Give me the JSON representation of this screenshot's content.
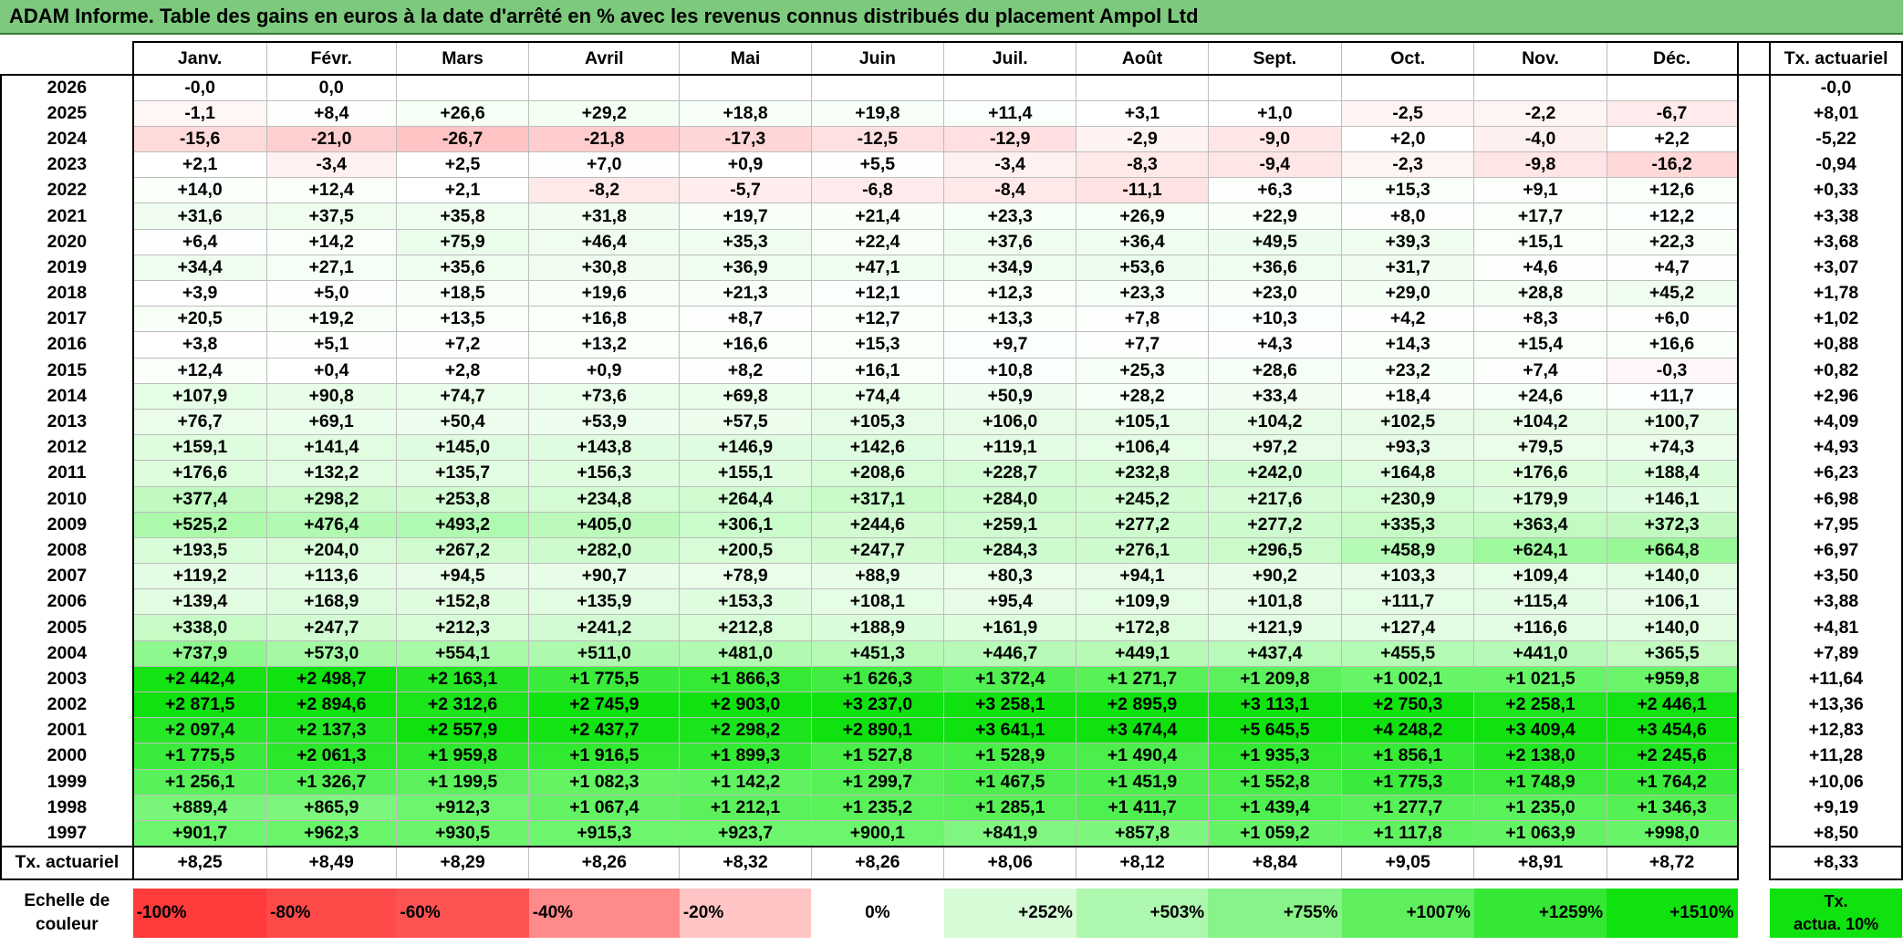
{
  "title": "ADAM Informe. Table des gains en euros à la date d'arrêté en % avec les revenus connus distribués du placement Ampol Ltd",
  "months": [
    "Janv.",
    "Févr.",
    "Mars",
    "Avril",
    "Mai",
    "Juin",
    "Juil.",
    "Août",
    "Sept.",
    "Oct.",
    "Nov.",
    "Déc."
  ],
  "tx_header": "Tx. actuariel",
  "rows": [
    {
      "year": "2026",
      "values": [
        "-0,0",
        "0,0",
        "",
        "",
        "",
        "",
        "",
        "",
        "",
        "",
        "",
        ""
      ],
      "tx": "-0,0"
    },
    {
      "year": "2025",
      "values": [
        "-1,1",
        "+8,4",
        "+26,6",
        "+29,2",
        "+18,8",
        "+19,8",
        "+11,4",
        "+3,1",
        "+1,0",
        "-2,5",
        "-2,2",
        "-6,7"
      ],
      "tx": "+8,01"
    },
    {
      "year": "2024",
      "values": [
        "-15,6",
        "-21,0",
        "-26,7",
        "-21,8",
        "-17,3",
        "-12,5",
        "-12,9",
        "-2,9",
        "-9,0",
        "+2,0",
        "-4,0",
        "+2,2"
      ],
      "tx": "-5,22"
    },
    {
      "year": "2023",
      "values": [
        "+2,1",
        "-3,4",
        "+2,5",
        "+7,0",
        "+0,9",
        "+5,5",
        "-3,4",
        "-8,3",
        "-9,4",
        "-2,3",
        "-9,8",
        "-16,2"
      ],
      "tx": "-0,94"
    },
    {
      "year": "2022",
      "values": [
        "+14,0",
        "+12,4",
        "+2,1",
        "-8,2",
        "-5,7",
        "-6,8",
        "-8,4",
        "-11,1",
        "+6,3",
        "+15,3",
        "+9,1",
        "+12,6"
      ],
      "tx": "+0,33"
    },
    {
      "year": "2021",
      "values": [
        "+31,6",
        "+37,5",
        "+35,8",
        "+31,8",
        "+19,7",
        "+21,4",
        "+23,3",
        "+26,9",
        "+22,9",
        "+8,0",
        "+17,7",
        "+12,2"
      ],
      "tx": "+3,38"
    },
    {
      "year": "2020",
      "values": [
        "+6,4",
        "+14,2",
        "+75,9",
        "+46,4",
        "+35,3",
        "+22,4",
        "+37,6",
        "+36,4",
        "+49,5",
        "+39,3",
        "+15,1",
        "+22,3"
      ],
      "tx": "+3,68"
    },
    {
      "year": "2019",
      "values": [
        "+34,4",
        "+27,1",
        "+35,6",
        "+30,8",
        "+36,9",
        "+47,1",
        "+34,9",
        "+53,6",
        "+36,6",
        "+31,7",
        "+4,6",
        "+4,7"
      ],
      "tx": "+3,07"
    },
    {
      "year": "2018",
      "values": [
        "+3,9",
        "+5,0",
        "+18,5",
        "+19,6",
        "+21,3",
        "+12,1",
        "+12,3",
        "+23,3",
        "+23,0",
        "+29,0",
        "+28,8",
        "+45,2"
      ],
      "tx": "+1,78"
    },
    {
      "year": "2017",
      "values": [
        "+20,5",
        "+19,2",
        "+13,5",
        "+16,8",
        "+8,7",
        "+12,7",
        "+13,3",
        "+7,8",
        "+10,3",
        "+4,2",
        "+8,3",
        "+6,0"
      ],
      "tx": "+1,02"
    },
    {
      "year": "2016",
      "values": [
        "+3,8",
        "+5,1",
        "+7,2",
        "+13,2",
        "+16,6",
        "+15,3",
        "+9,7",
        "+7,7",
        "+4,3",
        "+14,3",
        "+15,4",
        "+16,6"
      ],
      "tx": "+0,88"
    },
    {
      "year": "2015",
      "values": [
        "+12,4",
        "+0,4",
        "+2,8",
        "+0,9",
        "+8,2",
        "+16,1",
        "+10,8",
        "+25,3",
        "+28,6",
        "+23,2",
        "+7,4",
        "-0,3"
      ],
      "tx": "+0,82"
    },
    {
      "year": "2014",
      "values": [
        "+107,9",
        "+90,8",
        "+74,7",
        "+73,6",
        "+69,8",
        "+74,4",
        "+50,9",
        "+28,2",
        "+33,4",
        "+18,4",
        "+24,6",
        "+11,7"
      ],
      "tx": "+2,96"
    },
    {
      "year": "2013",
      "values": [
        "+76,7",
        "+69,1",
        "+50,4",
        "+53,9",
        "+57,5",
        "+105,3",
        "+106,0",
        "+105,1",
        "+104,2",
        "+102,5",
        "+104,2",
        "+100,7"
      ],
      "tx": "+4,09"
    },
    {
      "year": "2012",
      "values": [
        "+159,1",
        "+141,4",
        "+145,0",
        "+143,8",
        "+146,9",
        "+142,6",
        "+119,1",
        "+106,4",
        "+97,2",
        "+93,3",
        "+79,5",
        "+74,3"
      ],
      "tx": "+4,93"
    },
    {
      "year": "2011",
      "values": [
        "+176,6",
        "+132,2",
        "+135,7",
        "+156,3",
        "+155,1",
        "+208,6",
        "+228,7",
        "+232,8",
        "+242,0",
        "+164,8",
        "+176,6",
        "+188,4"
      ],
      "tx": "+6,23"
    },
    {
      "year": "2010",
      "values": [
        "+377,4",
        "+298,2",
        "+253,8",
        "+234,8",
        "+264,4",
        "+317,1",
        "+284,0",
        "+245,2",
        "+217,6",
        "+230,9",
        "+179,9",
        "+146,1"
      ],
      "tx": "+6,98"
    },
    {
      "year": "2009",
      "values": [
        "+525,2",
        "+476,4",
        "+493,2",
        "+405,0",
        "+306,1",
        "+244,6",
        "+259,1",
        "+277,2",
        "+277,2",
        "+335,3",
        "+363,4",
        "+372,3"
      ],
      "tx": "+7,95"
    },
    {
      "year": "2008",
      "values": [
        "+193,5",
        "+204,0",
        "+267,2",
        "+282,0",
        "+200,5",
        "+247,7",
        "+284,3",
        "+276,1",
        "+296,5",
        "+458,9",
        "+624,1",
        "+664,8"
      ],
      "tx": "+6,97"
    },
    {
      "year": "2007",
      "values": [
        "+119,2",
        "+113,6",
        "+94,5",
        "+90,7",
        "+78,9",
        "+88,9",
        "+80,3",
        "+94,1",
        "+90,2",
        "+103,3",
        "+109,4",
        "+140,0"
      ],
      "tx": "+3,50"
    },
    {
      "year": "2006",
      "values": [
        "+139,4",
        "+168,9",
        "+152,8",
        "+135,9",
        "+153,3",
        "+108,1",
        "+95,4",
        "+109,9",
        "+101,8",
        "+111,7",
        "+115,4",
        "+106,1"
      ],
      "tx": "+3,88"
    },
    {
      "year": "2005",
      "values": [
        "+338,0",
        "+247,7",
        "+212,3",
        "+241,2",
        "+212,8",
        "+188,9",
        "+161,9",
        "+172,8",
        "+121,9",
        "+127,4",
        "+116,6",
        "+140,0"
      ],
      "tx": "+4,81"
    },
    {
      "year": "2004",
      "values": [
        "+737,9",
        "+573,0",
        "+554,1",
        "+511,0",
        "+481,0",
        "+451,3",
        "+446,7",
        "+449,1",
        "+437,4",
        "+455,5",
        "+441,0",
        "+365,5"
      ],
      "tx": "+7,89"
    },
    {
      "year": "2003",
      "values": [
        "+2 442,4",
        "+2 498,7",
        "+2 163,1",
        "+1 775,5",
        "+1 866,3",
        "+1 626,3",
        "+1 372,4",
        "+1 271,7",
        "+1 209,8",
        "+1 002,1",
        "+1 021,5",
        "+959,8"
      ],
      "tx": "+11,64"
    },
    {
      "year": "2002",
      "values": [
        "+2 871,5",
        "+2 894,6",
        "+2 312,6",
        "+2 745,9",
        "+2 903,0",
        "+3 237,0",
        "+3 258,1",
        "+2 895,9",
        "+3 113,1",
        "+2 750,3",
        "+2 258,1",
        "+2 446,1"
      ],
      "tx": "+13,36"
    },
    {
      "year": "2001",
      "values": [
        "+2 097,4",
        "+2 137,3",
        "+2 557,9",
        "+2 437,7",
        "+2 298,2",
        "+2 890,1",
        "+3 641,1",
        "+3 474,4",
        "+5 645,5",
        "+4 248,2",
        "+3 409,4",
        "+3 454,6"
      ],
      "tx": "+12,83"
    },
    {
      "year": "2000",
      "values": [
        "+1 775,5",
        "+2 061,3",
        "+1 959,8",
        "+1 916,5",
        "+1 899,3",
        "+1 527,8",
        "+1 528,9",
        "+1 490,4",
        "+1 935,3",
        "+1 856,1",
        "+2 138,0",
        "+2 245,6"
      ],
      "tx": "+11,28"
    },
    {
      "year": "1999",
      "values": [
        "+1 256,1",
        "+1 326,7",
        "+1 199,5",
        "+1 082,3",
        "+1 142,2",
        "+1 299,7",
        "+1 467,5",
        "+1 451,9",
        "+1 552,8",
        "+1 775,3",
        "+1 748,9",
        "+1 764,2"
      ],
      "tx": "+10,06"
    },
    {
      "year": "1998",
      "values": [
        "+889,4",
        "+865,9",
        "+912,3",
        "+1 067,4",
        "+1 212,1",
        "+1 235,2",
        "+1 285,1",
        "+1 411,7",
        "+1 439,4",
        "+1 277,7",
        "+1 235,0",
        "+1 346,3"
      ],
      "tx": "+9,19"
    },
    {
      "year": "1997",
      "values": [
        "+901,7",
        "+962,3",
        "+930,5",
        "+915,3",
        "+923,7",
        "+900,1",
        "+841,9",
        "+857,8",
        "+1 059,2",
        "+1 117,8",
        "+1 063,9",
        "+998,0"
      ],
      "tx": "+8,50"
    }
  ],
  "footer": {
    "label": "Tx. actuariel",
    "values": [
      "+8,25",
      "+8,49",
      "+8,29",
      "+8,26",
      "+8,32",
      "+8,26",
      "+8,06",
      "+8,12",
      "+8,84",
      "+9,05",
      "+8,91",
      "+8,72"
    ],
    "total": "+8,33"
  },
  "scale": {
    "label_line1": "Echelle de",
    "label_line2": "couleur",
    "steps": [
      {
        "text": "-100%",
        "color": "#ff3b3b"
      },
      {
        "text": "-80%",
        "color": "#ff4a4a"
      },
      {
        "text": "-60%",
        "color": "#ff5252"
      },
      {
        "text": "-40%",
        "color": "#ff8a8a"
      },
      {
        "text": "-20%",
        "color": "#ffc4c4"
      },
      {
        "text": "0%",
        "color": "#ffffff"
      },
      {
        "text": "+252%",
        "color": "#d6fbd6"
      },
      {
        "text": "+503%",
        "color": "#aef7ae"
      },
      {
        "text": "+755%",
        "color": "#88f388"
      },
      {
        "text": "+1007%",
        "color": "#5eee5e"
      },
      {
        "text": "+1259%",
        "color": "#36e836"
      },
      {
        "text": "+1510%",
        "color": "#10e210"
      }
    ],
    "tx_line1": "Tx.",
    "tx_line2": "actua. 10%",
    "tx_color": "#10e210"
  },
  "colors": {
    "title_bg": "#7dc97d",
    "negative_max": "#ff4040",
    "positive_max": "#10e210",
    "neutral": "#ffffff"
  }
}
